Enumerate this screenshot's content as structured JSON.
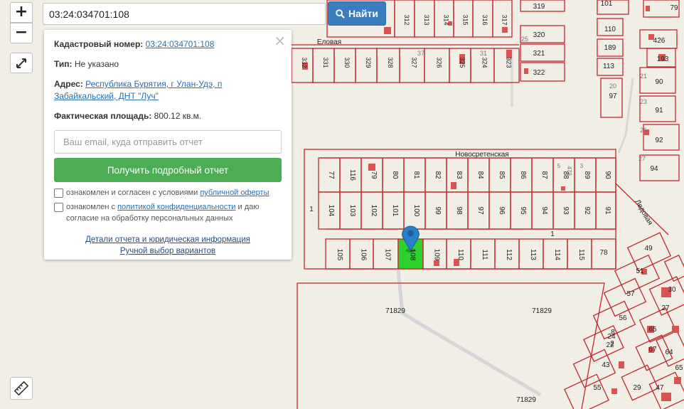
{
  "map": {
    "street_novosretenskaya": "Новосретенская",
    "street_elovaya": "Еловая",
    "street_ledovaya": "Ледовая",
    "parcel_area_labels": [
      "71829",
      "71829",
      "71829"
    ],
    "top_row_lots": [
      "312",
      "313",
      "314",
      "315",
      "316",
      "317"
    ],
    "elovaya_lots": [
      "332",
      "331",
      "330",
      "329",
      "328",
      "327",
      "326",
      "325",
      "324",
      "323"
    ],
    "elovaya_small": [
      "37",
      "31"
    ],
    "right_col_lots": [
      "319",
      "320",
      "321",
      "322",
      "25"
    ],
    "block_row1": [
      "77",
      "116",
      "79",
      "80",
      "81",
      "82",
      "83",
      "84",
      "85",
      "86",
      "87",
      "88",
      "89",
      "90"
    ],
    "block_row2": [
      "104",
      "103",
      "102",
      "101",
      "100",
      "99",
      "98",
      "97",
      "96",
      "95",
      "94",
      "93",
      "92",
      "91"
    ],
    "block_row3": [
      "105",
      "106",
      "107",
      "108",
      "109",
      "110",
      "111",
      "112",
      "113",
      "114",
      "115",
      "78"
    ],
    "block_side_label": "1",
    "block_side_label2": "1",
    "block_small": [
      "5",
      "3",
      "479"
    ],
    "far_right_lots": [
      "101",
      "79",
      "110",
      "426",
      "189",
      "193",
      "113",
      "21",
      "90",
      "20",
      "97",
      "23",
      "91",
      "26",
      "92",
      "27",
      "94"
    ],
    "se_lots": [
      "49",
      "51",
      "57",
      "56",
      "8",
      "22",
      "24",
      "2",
      "43",
      "55",
      "29",
      "47",
      "27",
      "65",
      "64",
      "67",
      "30",
      "65"
    ],
    "selected_lot": "108",
    "colors": {
      "parcel_border": "#c1272d",
      "selected_fill": "#2ed12e",
      "marker": "#2a80c8",
      "building": "#d9534f"
    }
  },
  "controls": {
    "zoom_in": "+",
    "zoom_out": "−",
    "fullscreen_icon": "fullscreen-icon",
    "ruler_icon": "ruler-icon"
  },
  "search": {
    "value": "03:24:034701:108",
    "button_label": "Найти",
    "button_icon": "search-icon"
  },
  "panel": {
    "cadastral_label": "Кадастровый номер:",
    "cadastral_value": "03:24:034701:108",
    "type_label": "Тип:",
    "type_value": "Не указано",
    "address_label": "Адрес:",
    "address_value": "Республика Бурятия, г Улан-Удэ, п Забайкальский, ДНТ \"Луч\"",
    "area_label": "Фактическая площадь:",
    "area_value": "800.12 кв.м.",
    "email_placeholder": "Ваш email, куда отправить отчет",
    "report_button": "Получить подробный отчет",
    "check1_text": "ознакомлен и согласен с условиями ",
    "check1_link": "публичной оферты",
    "check2_text": "ознакомлен с ",
    "check2_link": "политикой конфиденциальности",
    "check2_text2": " и даю согласие на обработку персональных данных",
    "details_link": "Детали отчета и юридическая информация",
    "manual_link": "Ручной выбор вариантов",
    "close": "×"
  }
}
